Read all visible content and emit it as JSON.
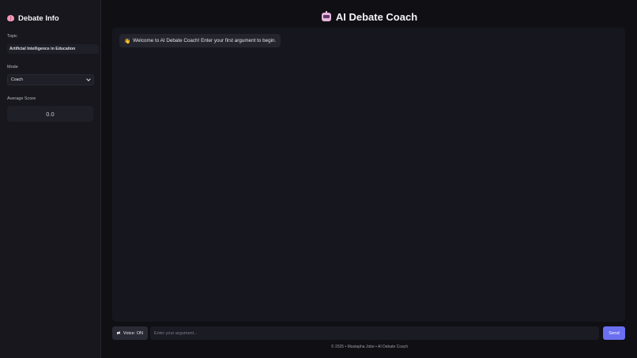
{
  "sidebar": {
    "title": "Debate Info",
    "topic_label": "Topic",
    "topic_value": "Artificial Intelligence in Education",
    "mode_label": "Mode",
    "mode_selected": "Coach",
    "score_label": "Average Score",
    "score_value": "0.0"
  },
  "header": {
    "title": "AI Debate Coach",
    "icon": "robot-icon"
  },
  "chat": {
    "messages": [
      {
        "icon": "wave-icon",
        "emoji": "👋",
        "text": "Welcome to AI Debate Coach! Enter your first argument to begin."
      }
    ]
  },
  "input_bar": {
    "voice_label": "Voice: ON",
    "placeholder": "Enter your argument...",
    "send_label": "Send"
  },
  "footer": {
    "text": "© 2025 • Mustapha Jobe • AI Debate Coach"
  },
  "colors": {
    "accent": "#6a6ff0",
    "background": "#0f0f14",
    "sidebar": "#17171d"
  }
}
